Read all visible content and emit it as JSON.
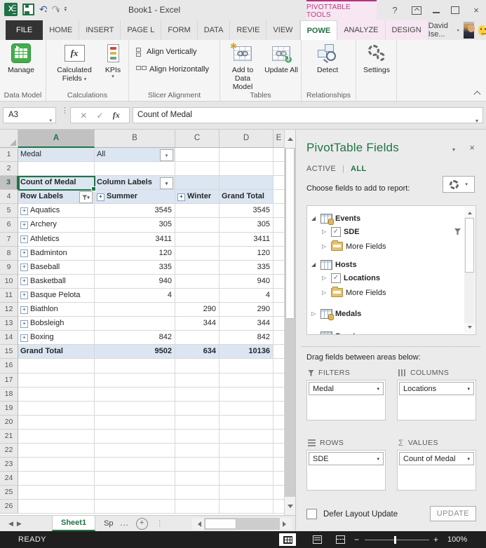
{
  "title_bar": {
    "title": "Book1 - Excel",
    "contextual_label": "PIVOTTABLE TOOLS",
    "help": "?"
  },
  "tabs": [
    "FILE",
    "HOME",
    "INSERT",
    "PAGE L",
    "FORM",
    "DATA",
    "REVIE",
    "VIEW",
    "POWE",
    "ANALYZE",
    "DESIGN"
  ],
  "user": {
    "name": "David Ise..."
  },
  "ribbon": {
    "manage": "Manage",
    "data_model_group": "Data Model",
    "calculated_fields": "Calculated Fields",
    "kpis": "KPIs",
    "calculations_group": "Calculations",
    "align_vertically": "Align Vertically",
    "align_horizontally": "Align Horizontally",
    "slicer_group": "Slicer Alignment",
    "add_to_data_model": "Add to Data Model",
    "update_all": "Update All",
    "tables_group": "Tables",
    "detect": "Detect",
    "relationships_group": "Relationships",
    "settings": "Settings"
  },
  "formula_bar": {
    "name_box": "A3",
    "formula": "Count of Medal"
  },
  "grid": {
    "columns": [
      "A",
      "B",
      "C",
      "D",
      "E"
    ],
    "r1": {
      "n": "1",
      "a": "Medal",
      "b": "All"
    },
    "r2": {
      "n": "2"
    },
    "r3": {
      "n": "3",
      "a": "Count of Medal",
      "b": "Column Labels"
    },
    "r4": {
      "n": "4",
      "a": "Row Labels",
      "b": "Summer",
      "c": "Winter",
      "d": "Grand Total"
    },
    "data_rows": [
      {
        "n": "5",
        "sport": "Aquatics",
        "summer": "3545",
        "winter": "",
        "total": "3545"
      },
      {
        "n": "6",
        "sport": "Archery",
        "summer": "305",
        "winter": "",
        "total": "305"
      },
      {
        "n": "7",
        "sport": "Athletics",
        "summer": "3411",
        "winter": "",
        "total": "3411"
      },
      {
        "n": "8",
        "sport": "Badminton",
        "summer": "120",
        "winter": "",
        "total": "120"
      },
      {
        "n": "9",
        "sport": "Baseball",
        "summer": "335",
        "winter": "",
        "total": "335"
      },
      {
        "n": "10",
        "sport": "Basketball",
        "summer": "940",
        "winter": "",
        "total": "940"
      },
      {
        "n": "11",
        "sport": "Basque Pelota",
        "summer": "4",
        "winter": "",
        "total": "4"
      },
      {
        "n": "12",
        "sport": "Biathlon",
        "summer": "",
        "winter": "290",
        "total": "290"
      },
      {
        "n": "13",
        "sport": "Bobsleigh",
        "summer": "",
        "winter": "344",
        "total": "344"
      },
      {
        "n": "14",
        "sport": "Boxing",
        "summer": "842",
        "winter": "",
        "total": "842"
      }
    ],
    "r15": {
      "n": "15",
      "a": "Grand Total",
      "b": "9502",
      "c": "634",
      "d": "10136"
    },
    "empty_rows": [
      "16",
      "17",
      "18",
      "19",
      "20",
      "21",
      "22",
      "23",
      "24",
      "25",
      "26"
    ]
  },
  "fields_pane": {
    "title": "PivotTable Fields",
    "tab_active": "ACTIVE",
    "tab_all": "ALL",
    "choose_label": "Choose fields to add to report:",
    "tree": [
      {
        "label": "Events"
      },
      {
        "label": "SDE",
        "checked": true
      },
      {
        "label": "More Fields"
      },
      {
        "label": "Hosts"
      },
      {
        "label": "Locations",
        "checked": true
      },
      {
        "label": "More Fields"
      },
      {
        "label": "Medals"
      },
      {
        "label": "Sports"
      }
    ],
    "drag_label": "Drag fields between areas below:",
    "areas": {
      "filters": {
        "label": "FILTERS",
        "field": "Medal"
      },
      "columns": {
        "label": "COLUMNS",
        "field": "Locations"
      },
      "rows": {
        "label": "ROWS",
        "field": "SDE"
      },
      "values": {
        "label": "VALUES",
        "field": "Count of Medal"
      }
    },
    "defer_label": "Defer Layout Update",
    "update_button": "UPDATE"
  },
  "sheet_bar": {
    "sheet1": "Sheet1",
    "sheet2": "Sp",
    "overflow": "..."
  },
  "status_bar": {
    "status": "READY",
    "zoom_level": "100%"
  }
}
